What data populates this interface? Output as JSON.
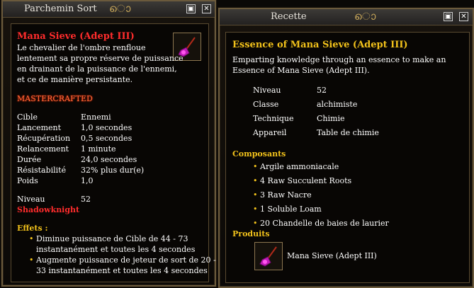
{
  "left_window": {
    "title": "Parchemin Sort",
    "spell_name": "Mana Sieve (Adept III)",
    "description": [
      "Le chevalier de l'ombre renfloue",
      "lentement sa propre réserve de puissance",
      "en drainant de la puissance de l'ennemi,",
      "et ce de manière persistante."
    ],
    "tag": "MASTERCRAFTED",
    "stats": [
      {
        "label": "Cible",
        "value": "Ennemi"
      },
      {
        "label": "Lancement",
        "value": "1,0 secondes"
      },
      {
        "label": "Récupération",
        "value": "0,5 secondes"
      },
      {
        "label": "Relancement",
        "value": "1 minute"
      },
      {
        "label": "Durée",
        "value": "24,0 secondes"
      },
      {
        "label": "Résistabilité",
        "value": "32% plus dur(e)"
      },
      {
        "label": "Poids",
        "value": "1,0"
      }
    ],
    "level_label": "Niveau",
    "level_value": "52",
    "class": "Shadowknight",
    "effects_heading": "Effets :",
    "effects": [
      [
        "Diminue puissance de Cible  de 44 - 73",
        "instantanément et toutes les 4 secondes"
      ],
      [
        "Augmente puissance de jeteur de sort de 20 -",
        "33 instantanément et toutes les 4 secondes"
      ]
    ],
    "icon": "spell-icon",
    "buttons": {
      "minimize": "▣",
      "close": "✕"
    }
  },
  "right_window": {
    "title": "Recette",
    "recipe_name": "Essence of Mana Sieve (Adept III)",
    "description": [
      "Emparting knowledge through an essence to make an",
      "Essence of Mana Sieve (Adept III)."
    ],
    "info": [
      {
        "label": "Niveau",
        "value": "52"
      },
      {
        "label": "Classe",
        "value": "alchimiste"
      },
      {
        "label": "Technique",
        "value": "Chimie"
      },
      {
        "label": "Appareil",
        "value": "Table de chimie"
      }
    ],
    "components_heading": "Composants",
    "components": [
      "Argile ammoniacale",
      "4 Raw Succulent Roots",
      "3 Raw Nacre",
      "1 Soluble Loam",
      "20 Chandelle de baies de laurier"
    ],
    "products_heading": "Produits",
    "product": "Mana Sieve (Adept III)",
    "icon": "spell-icon",
    "buttons": {
      "minimize": "▣",
      "close": "✕"
    }
  },
  "colors": {
    "accent": "#f2c21b",
    "class": "#ff2c2c",
    "border": "#6b5a3c"
  }
}
